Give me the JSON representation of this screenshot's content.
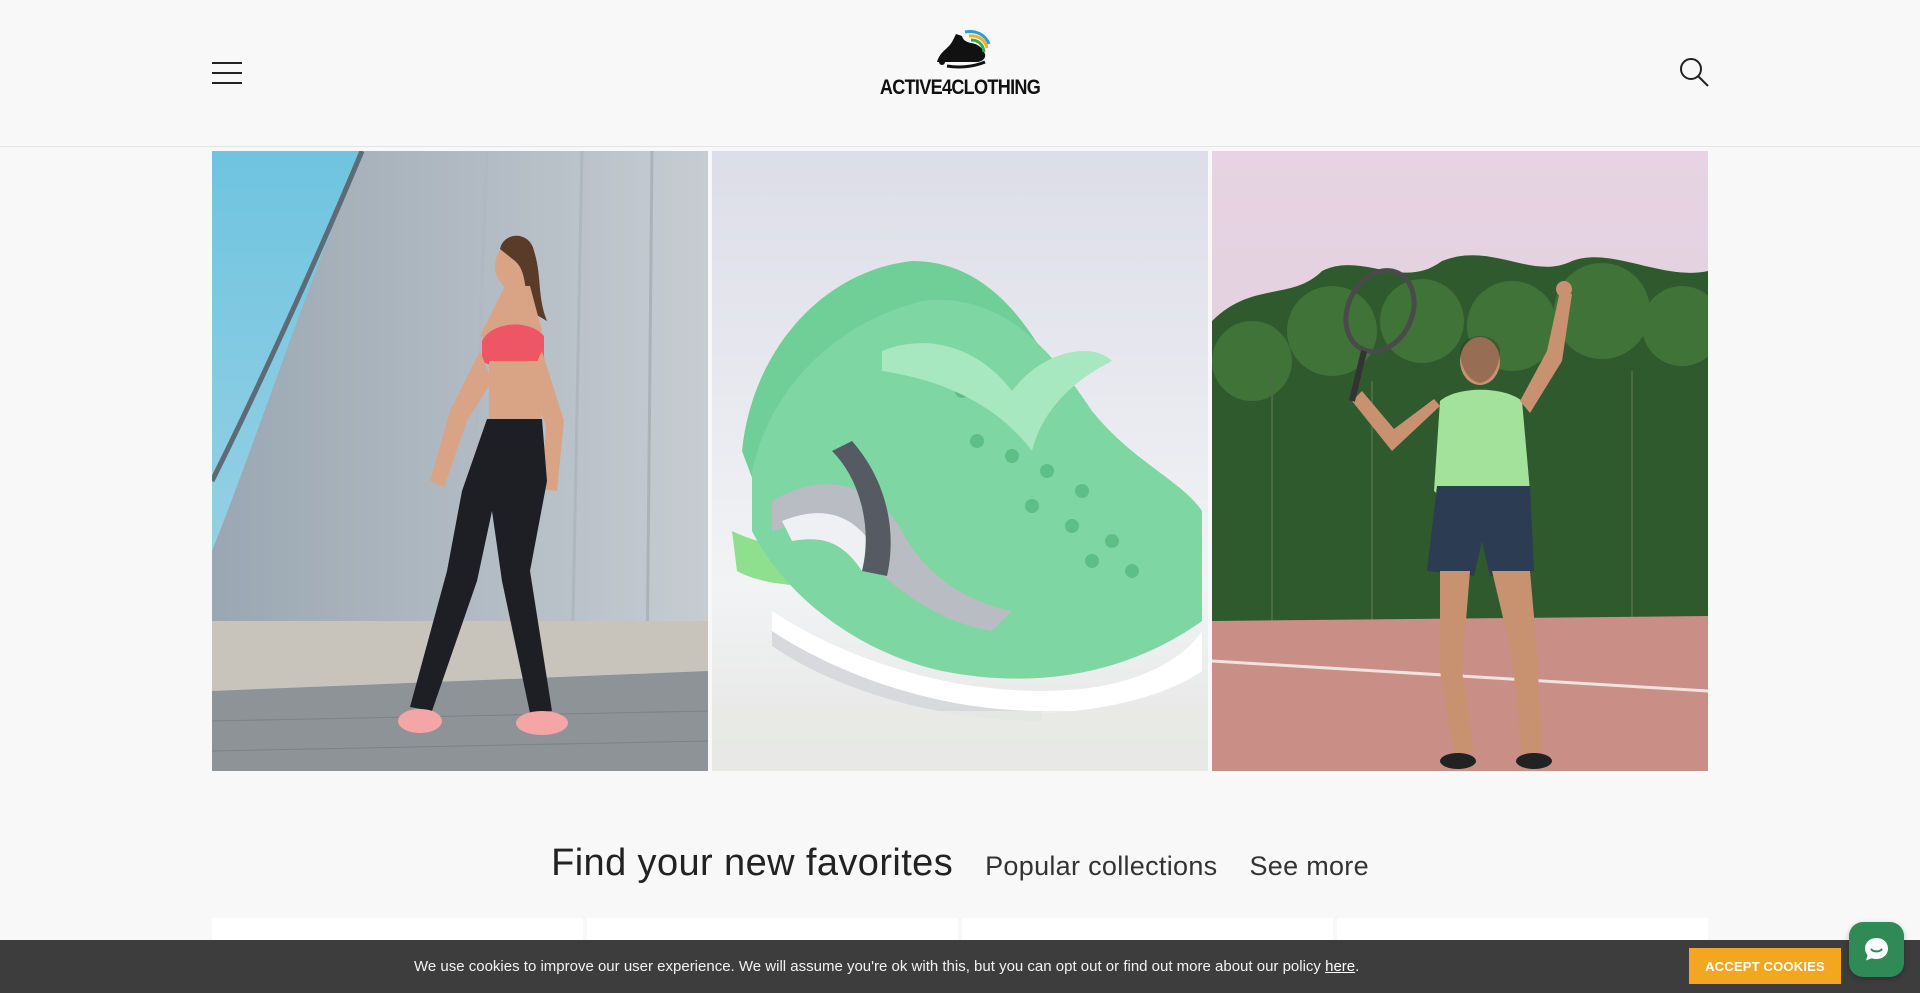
{
  "header": {
    "menu_icon": "hamburger-menu-icon",
    "logo_text": "ACTIVE4CLOTHING",
    "logo_icon": "running-shoe-logo",
    "search_icon": "search-icon"
  },
  "gallery": {
    "tiles": [
      {
        "subject": "woman-runner-resting-photo"
      },
      {
        "subject": "green-silver-sneaker-photo"
      },
      {
        "subject": "man-tennis-serve-photo"
      }
    ]
  },
  "section": {
    "heading": "Find your new favorites",
    "popular_link": "Popular collections",
    "see_more_link": "See more"
  },
  "cookie": {
    "message": "We use cookies to improve our user experience. We will assume you're ok with this, but you can opt out or find out more about our policy ",
    "link_text": "here",
    "period": ".",
    "accept_label": "ACCEPT COOKIES"
  },
  "chat": {
    "icon": "chat-bubble-icon"
  },
  "colors": {
    "background": "#f8f8f8",
    "cookie_bar": "#3d3d3d",
    "accept_button": "#f2a71f",
    "chat_button": "#2f8a55"
  }
}
